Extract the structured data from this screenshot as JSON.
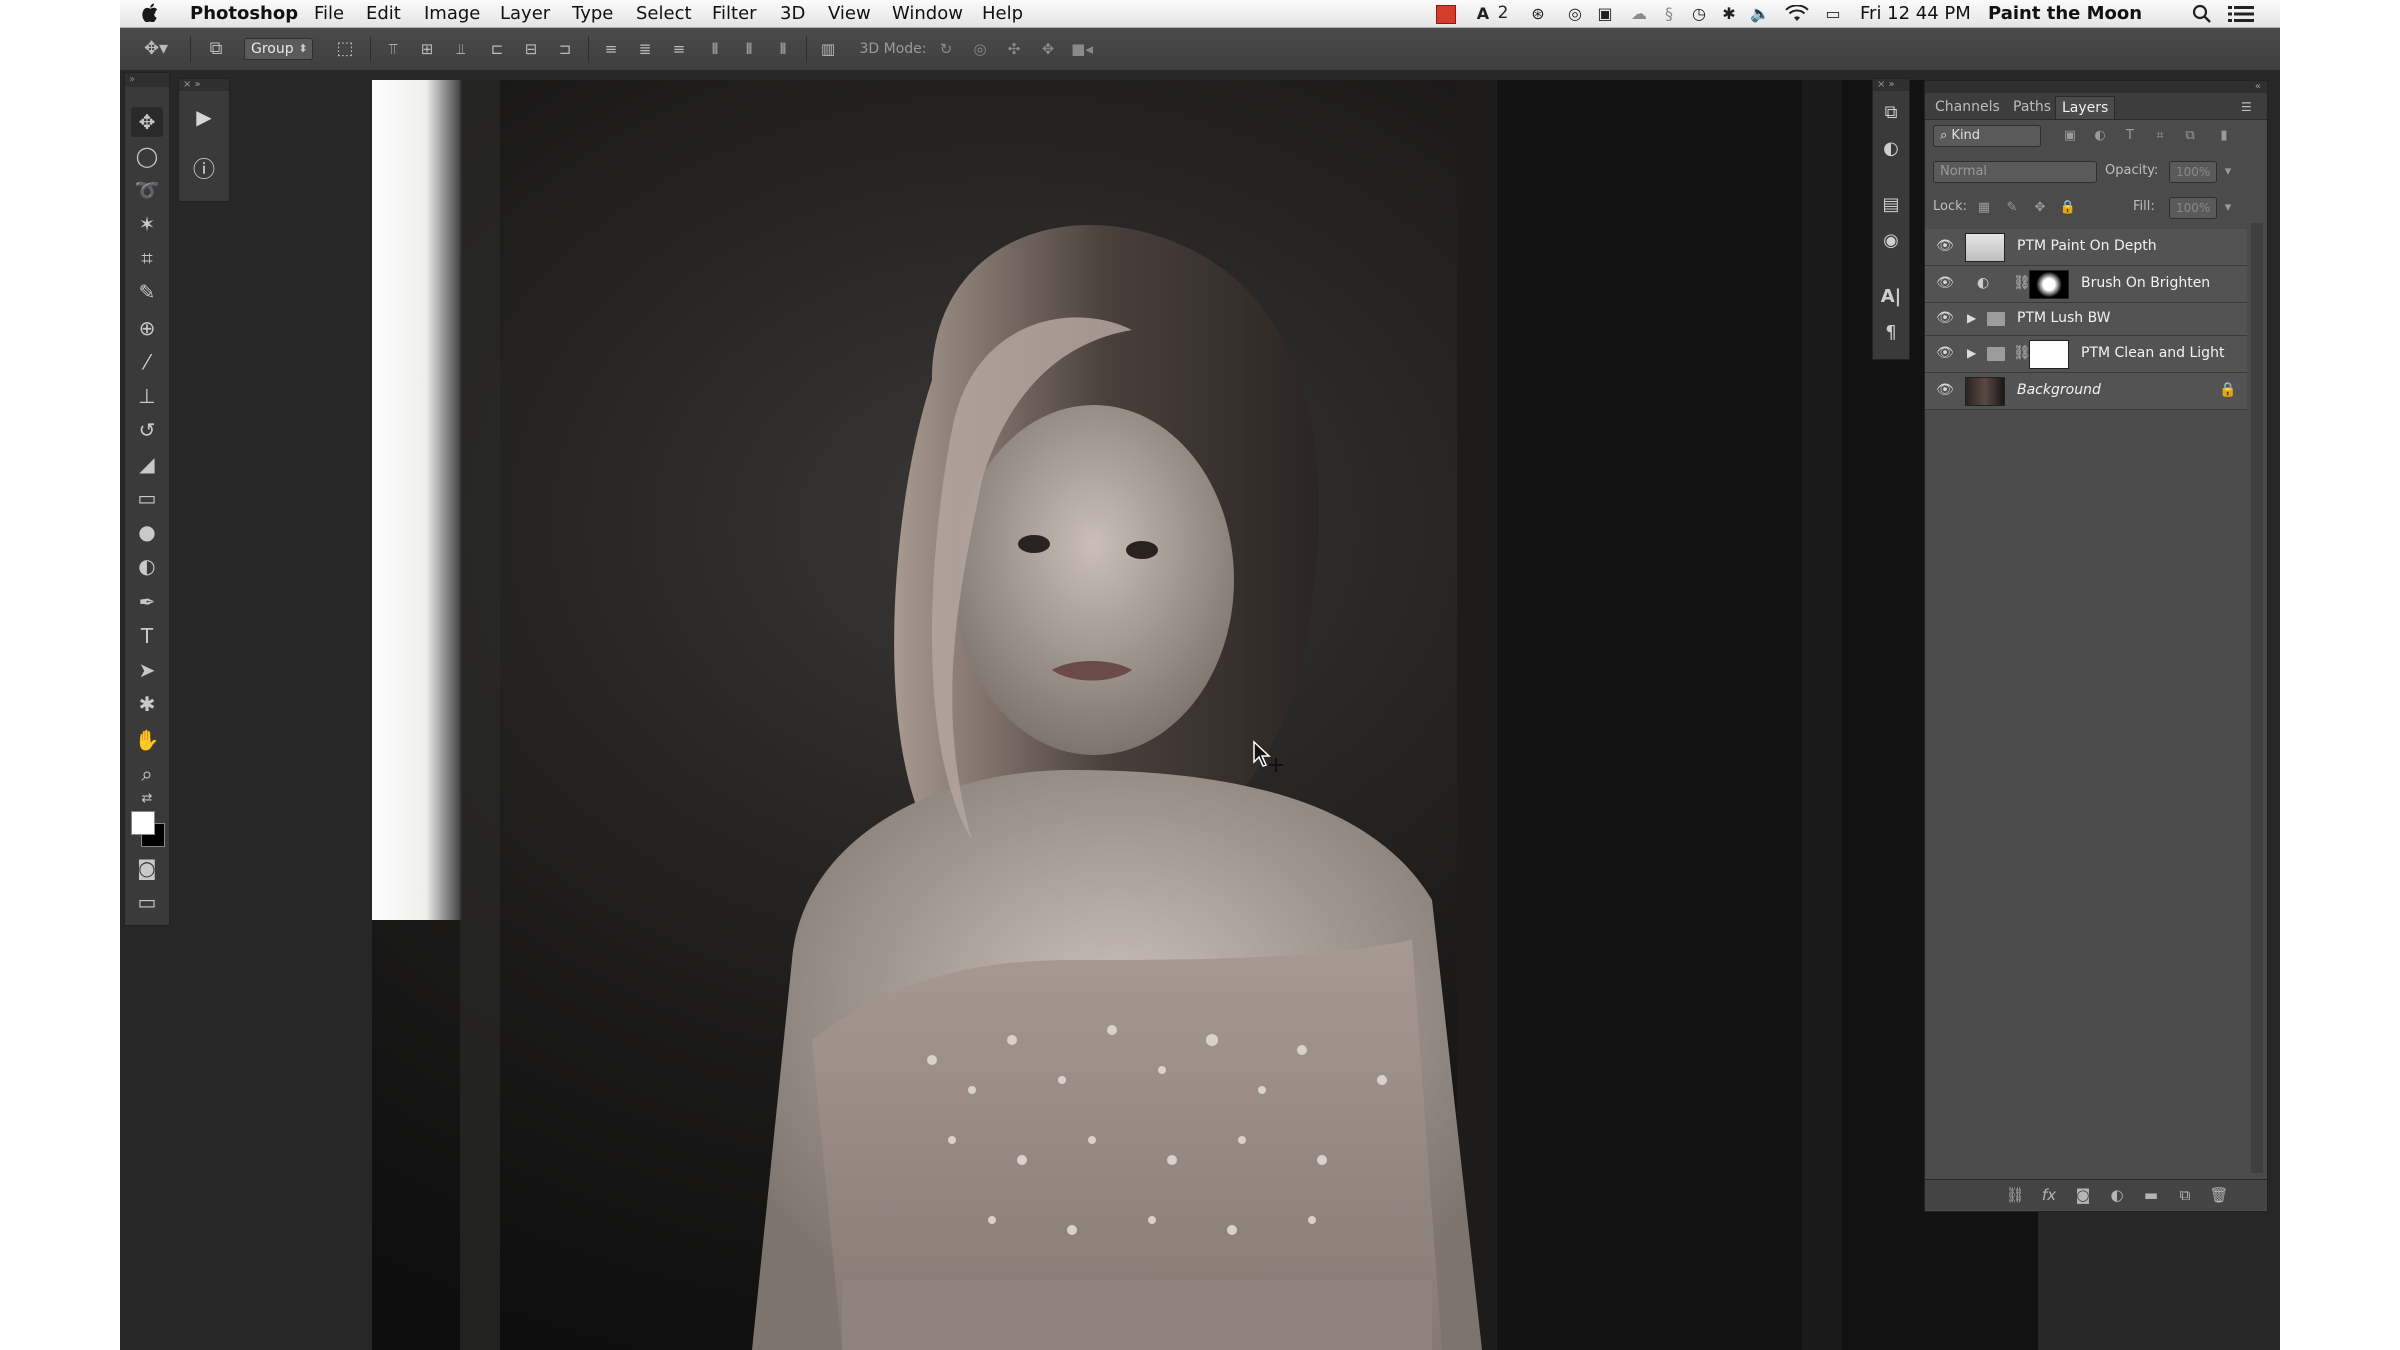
{
  "menubar": {
    "app_name": "Photoshop",
    "menus": [
      "File",
      "Edit",
      "Image",
      "Layer",
      "Type",
      "Select",
      "Filter",
      "3D",
      "View",
      "Window",
      "Help"
    ],
    "notification_count": "2",
    "clock": "Fri 12 44 PM",
    "user": "Paint the Moon"
  },
  "options_bar": {
    "auto_select_value": "Group",
    "mode_label": "3D Mode:"
  },
  "layers_panel": {
    "tabs": [
      "Channels",
      "Paths",
      "Layers"
    ],
    "active_tab": "Layers",
    "filter_kind": "Kind",
    "blend_mode": "Normal",
    "opacity_label": "Opacity:",
    "opacity_value": "100%",
    "lock_label": "Lock:",
    "fill_label": "Fill:",
    "fill_value": "100%",
    "layers": [
      {
        "name": "PTM Paint On Depth"
      },
      {
        "name": "Brush On Brighten"
      },
      {
        "name": "PTM Lush BW"
      },
      {
        "name": "PTM Clean and Light"
      },
      {
        "name": "Background"
      }
    ]
  },
  "colors": {
    "panel_bg": "#4b4b4b",
    "workspace_bg": "#272727",
    "menubar_bg": "#ececec",
    "record_indicator": "#d63c2c"
  }
}
